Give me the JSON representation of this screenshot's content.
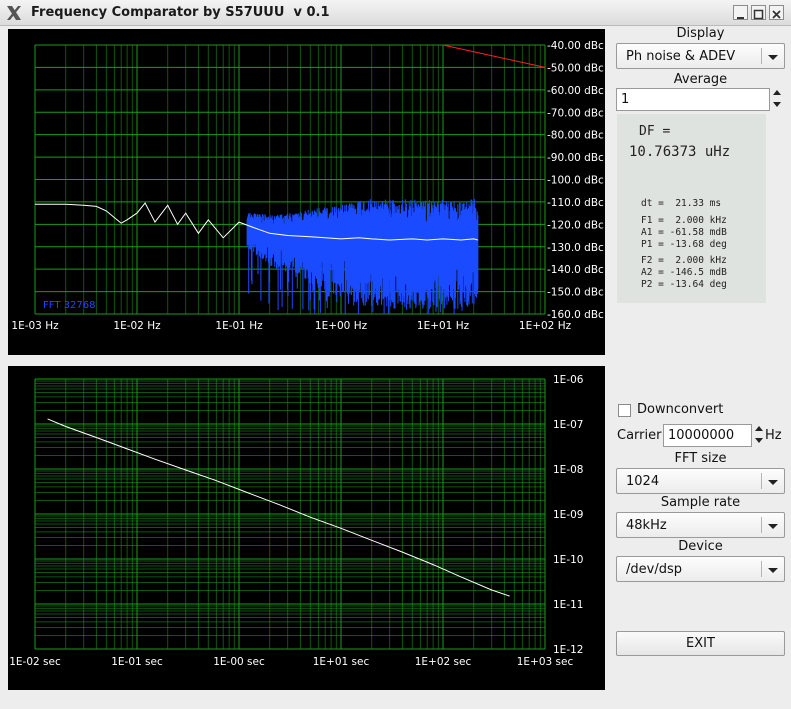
{
  "window": {
    "title": "Frequency Comparator by S57UUU  v 0.1"
  },
  "display": {
    "label": "Display",
    "selected": "Ph noise & ADEV"
  },
  "average": {
    "label": "Average",
    "value": "1"
  },
  "info": {
    "df_label": "DF =",
    "df_value": "10.76373 uHz",
    "dt": "dt =  21.33 ms",
    "f1": "F1 =  2.000 kHz",
    "a1": "A1 = -61.58 mdB",
    "p1": "P1 = -13.68 deg",
    "f2": "F2 =  2.000 kHz",
    "a2": "A2 = -146.5 mdB",
    "p2": "P2 = -13.64 deg"
  },
  "downconvert": {
    "label": "Downconvert",
    "checked": false
  },
  "carrier": {
    "label": "Carrier",
    "value": "10000000",
    "unit": "Hz"
  },
  "fft_size": {
    "label": "FFT size",
    "selected": "1024"
  },
  "sample_rate": {
    "label": "Sample rate",
    "selected": "48kHz"
  },
  "device": {
    "label": "Device",
    "selected": "/dev/dsp"
  },
  "exit_label": "EXIT",
  "colors": {
    "grid": "#1e9a1e",
    "spectrum": "#1a4bff",
    "trace": "#ffffff",
    "reference": "#ff2020",
    "panel": "#000000"
  },
  "chart_data": [
    {
      "type": "line",
      "title": "",
      "xlabel": "",
      "ylabel": "",
      "x_scale": "log",
      "xlim": [
        0.001,
        100
      ],
      "ylim": [
        -160,
        -40
      ],
      "x_tick_labels": [
        "1E-03 Hz",
        "1E-02 Hz",
        "1E-01 Hz",
        "1E+00 Hz",
        "1E+01 Hz",
        "1E+02 Hz"
      ],
      "y_tick_labels": [
        "-40.00 dBc",
        "-50.00 dBc",
        "-60.00 dBc",
        "-70.00 dBc",
        "-80.00 dBc",
        "-90.00 dBc",
        "-100.0 dBc",
        "-110.0 dBc",
        "-120.0 dBc",
        "-130.0 dBc",
        "-140.0 dBc",
        "-150.0 dBc",
        "-160.0 dBc"
      ],
      "annotation": "FFT 32768",
      "grid": true,
      "series": [
        {
          "role": "averaged",
          "color": "#ffffff",
          "x": [
            0.001,
            0.002,
            0.003,
            0.004,
            0.005,
            0.006,
            0.007,
            0.008,
            0.01,
            0.012,
            0.015,
            0.02,
            0.025,
            0.03,
            0.04,
            0.05,
            0.07,
            0.1,
            0.15,
            0.2,
            0.3,
            0.5,
            0.7,
            1,
            1.5,
            2,
            3,
            5,
            7,
            10,
            15,
            20,
            22
          ],
          "y": [
            -111,
            -111,
            -111.5,
            -112,
            -114,
            -117,
            -119.5,
            -118,
            -115,
            -110.5,
            -119,
            -111.5,
            -120,
            -115,
            -124,
            -118,
            -126,
            -119,
            -122,
            -124,
            -125,
            -125.5,
            -126,
            -126.5,
            -126,
            -126.5,
            -127,
            -126.5,
            -127,
            -126.5,
            -127,
            -126.5,
            -127
          ]
        },
        {
          "role": "reference",
          "color": "#ff2020",
          "x": [
            10,
            100
          ],
          "y": [
            -40,
            -50
          ]
        }
      ]
    },
    {
      "type": "line",
      "title": "",
      "xlabel": "",
      "ylabel": "",
      "x_scale": "log",
      "y_scale": "log",
      "xlim": [
        0.01,
        1000
      ],
      "ylim": [
        1e-12,
        1e-06
      ],
      "x_tick_labels": [
        "1E-02 sec",
        "1E-01 sec",
        "1E-00 sec",
        "1E+01 sec",
        "1E+02 sec",
        "1E+03 sec"
      ],
      "y_tick_labels": [
        "1E-06",
        "1E-07",
        "1E-08",
        "1E-09",
        "1E-10",
        "1E-11",
        "1E-12"
      ],
      "grid": true,
      "series": [
        {
          "role": "adev",
          "color": "#ffffff",
          "x": [
            0.0133,
            0.02,
            0.04,
            0.08,
            0.15,
            0.3,
            0.6,
            1.2,
            2.5,
            5,
            10,
            20,
            40,
            80,
            150,
            300,
            450
          ],
          "y": [
            1.3e-07,
            8.8e-08,
            5e-08,
            2.8e-08,
            1.65e-08,
            9.5e-09,
            5.5e-09,
            3e-09,
            1.6e-09,
            8.5e-10,
            4.8e-10,
            2.6e-10,
            1.42e-10,
            7.5e-11,
            4e-11,
            2.05e-11,
            1.5e-11
          ]
        }
      ]
    }
  ]
}
